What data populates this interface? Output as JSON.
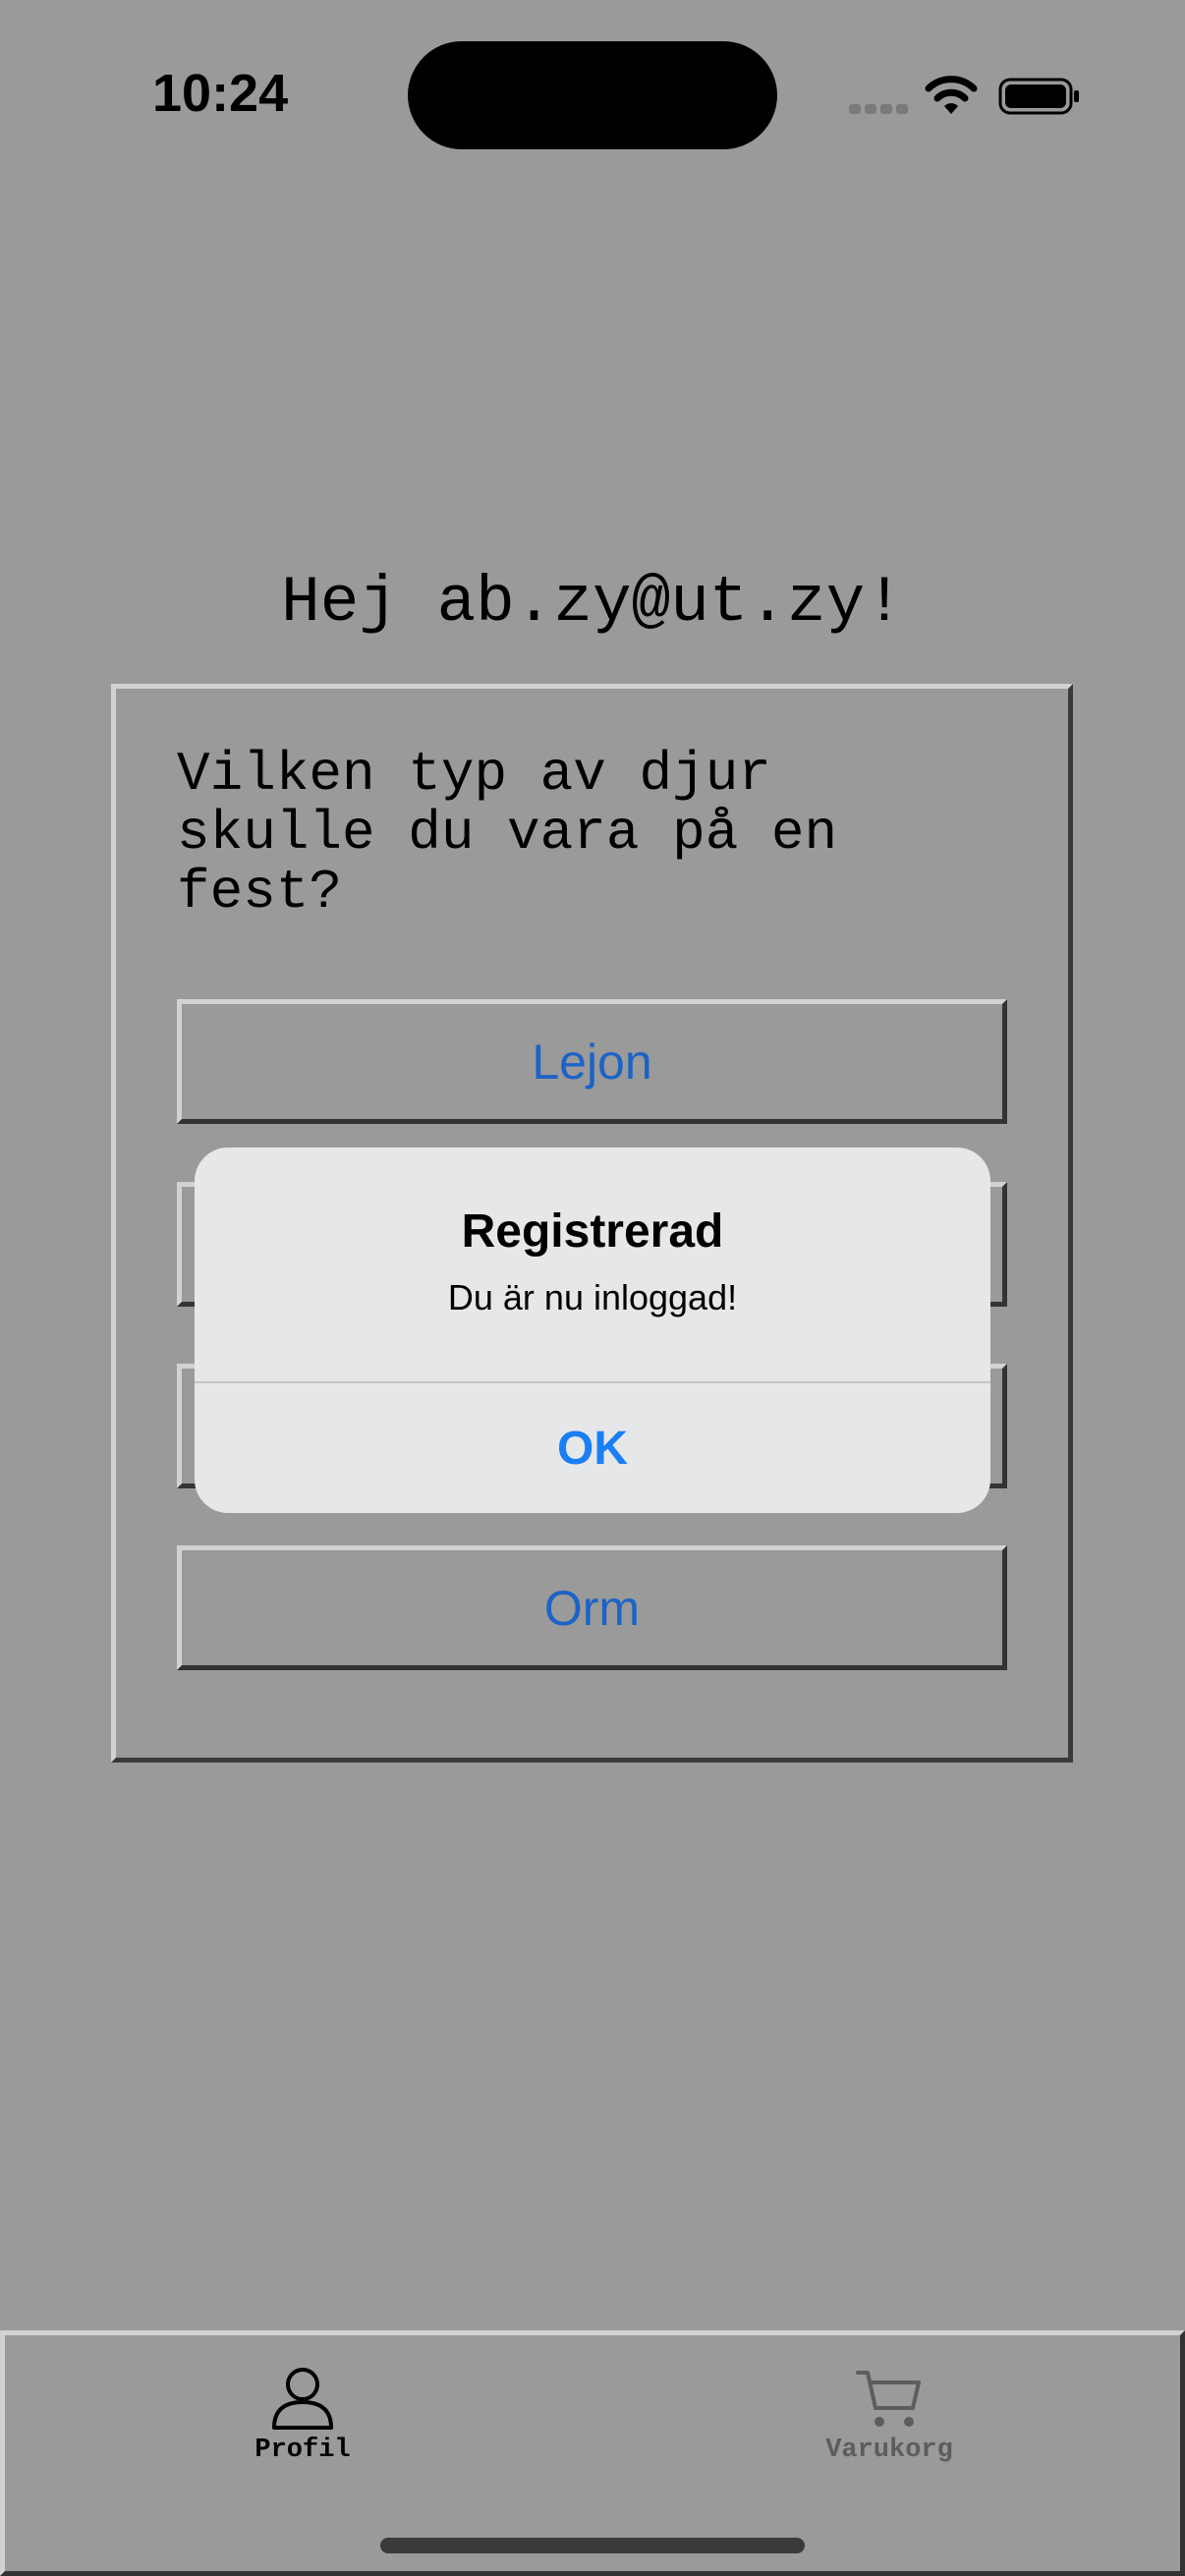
{
  "status_bar": {
    "time": "10:24"
  },
  "greeting": "Hej ab.zy@ut.zy!",
  "quiz": {
    "question": "Vilken typ av djur skulle du vara på en fest?",
    "answers": [
      "Lejon",
      "",
      "",
      "Orm"
    ]
  },
  "alert": {
    "title": "Registrerad",
    "message": "Du är nu inloggad!",
    "ok_label": "OK"
  },
  "tab_bar": {
    "items": [
      {
        "label": "Profil",
        "icon": "person-icon",
        "selected": true
      },
      {
        "label": "Varukorg",
        "icon": "cart-icon",
        "selected": false
      }
    ]
  },
  "colors": {
    "background": "#9a9a9a",
    "button_text": "#1c63c7",
    "alert_ok": "#1a7ff5"
  }
}
